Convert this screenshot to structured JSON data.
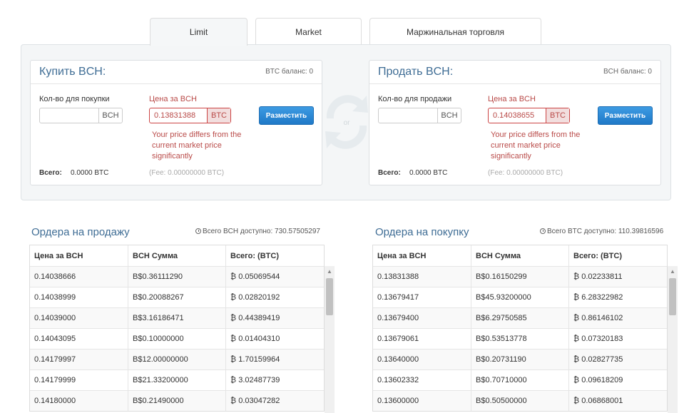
{
  "tabs": [
    {
      "label": "Limit",
      "active": true
    },
    {
      "label": "Market",
      "active": false
    },
    {
      "label": "Маржинальная торговля",
      "active": false
    }
  ],
  "buy": {
    "title": "Купить BCH:",
    "balance": "BTC баланс: 0",
    "qty_label": "Кол-во для покупки",
    "qty_value": "",
    "qty_unit": "BCH",
    "price_label": "Цена за BCH",
    "price_value": "0.13831388",
    "price_unit": "BTC",
    "warning": "Your price differs from the current market price significantly",
    "button": "Разместить",
    "total_label": "Всего:",
    "total_value": "0.0000 BTC",
    "fee": "(Fee: 0.00000000 BTC)"
  },
  "sell": {
    "title": "Продать BCH:",
    "balance": "BCH баланс: 0",
    "qty_label": "Кол-во для продажи",
    "qty_value": "",
    "qty_unit": "BCH",
    "price_label": "Цена за BCH",
    "price_value": "0.14038655",
    "price_unit": "BTC",
    "warning": "Your price differs from the current market price significantly",
    "button": "Разместить",
    "total_label": "Всего:",
    "total_value": "0.0000 BTC",
    "fee": "(Fee: 0.00000000 BTC)"
  },
  "swap_label": "or",
  "sell_orders": {
    "title": "Ордера на продажу",
    "available": "Всего BCH доступно: 730.57505297",
    "headers": [
      "Цена за BCH",
      "BCH Сумма",
      "Всего: (BTC)"
    ],
    "rows": [
      [
        "0.14038666",
        "B$0.36111290",
        "₿ 0.05069544"
      ],
      [
        "0.14038999",
        "B$0.20088267",
        "₿ 0.02820192"
      ],
      [
        "0.14039000",
        "B$3.16186471",
        "₿ 0.44389419"
      ],
      [
        "0.14043095",
        "B$0.10000000",
        "₿ 0.01404310"
      ],
      [
        "0.14179997",
        "B$12.00000000",
        "₿ 1.70159964"
      ],
      [
        "0.14179999",
        "B$21.33200000",
        "₿ 3.02487739"
      ],
      [
        "0.14180000",
        "B$0.21490000",
        "₿ 0.03047282"
      ]
    ]
  },
  "buy_orders": {
    "title": "Ордера на покупку",
    "available": "Всего BTC доступно: 110.39816596",
    "headers": [
      "Цена за BCH",
      "BCH Сумма",
      "Всего: (BTC)"
    ],
    "rows": [
      [
        "0.13831388",
        "B$0.16150299",
        "₿ 0.02233811"
      ],
      [
        "0.13679417",
        "B$45.93200000",
        "₿ 6.28322982"
      ],
      [
        "0.13679400",
        "B$6.29750585",
        "₿ 0.86146102"
      ],
      [
        "0.13679061",
        "B$0.53513778",
        "₿ 0.07320183"
      ],
      [
        "0.13640000",
        "B$0.20731190",
        "₿ 0.02827735"
      ],
      [
        "0.13602332",
        "B$0.70710000",
        "₿ 0.09618209"
      ],
      [
        "0.13600000",
        "B$0.50500000",
        "₿ 0.06868001"
      ]
    ]
  }
}
